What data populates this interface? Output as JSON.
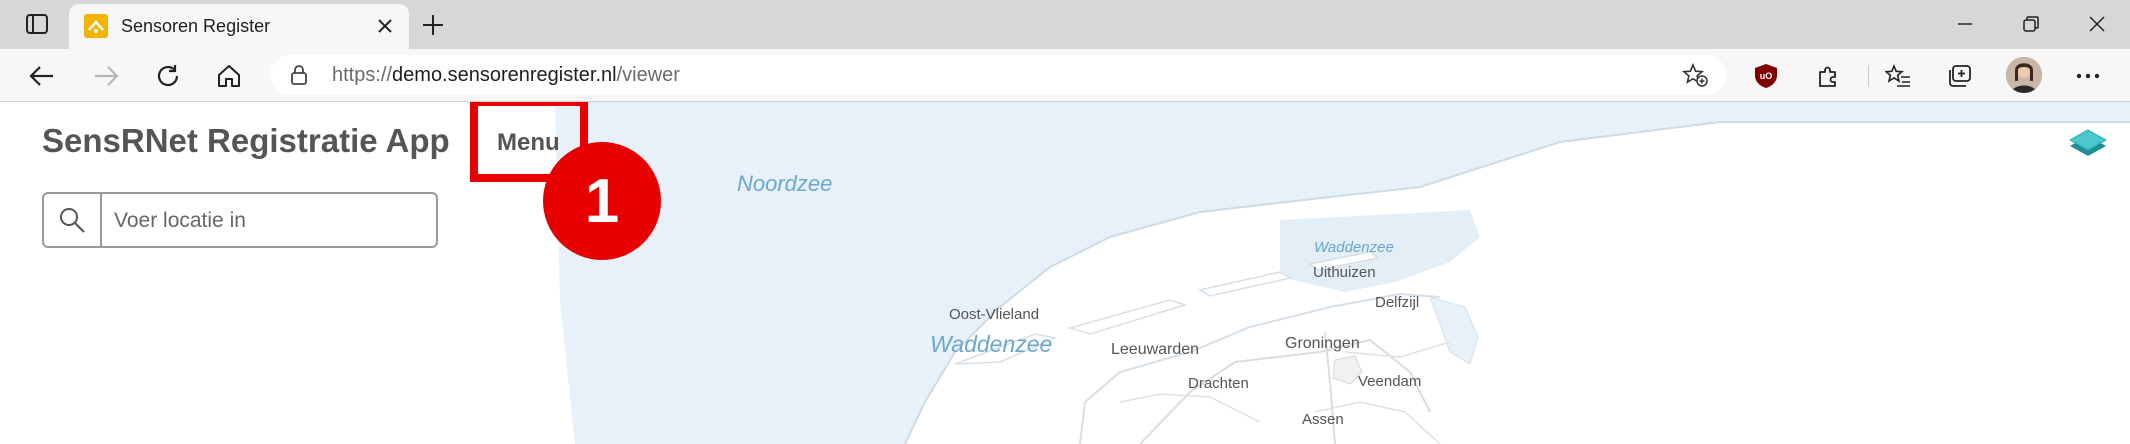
{
  "browser": {
    "tab": {
      "title": "Sensoren Register"
    },
    "address": {
      "protocol": "https://",
      "host": "demo.sensorenregister.nl",
      "path": "/viewer"
    }
  },
  "app": {
    "title": "SensRNet Registratie App",
    "menu_label": "Menu",
    "step_number": "1",
    "search": {
      "placeholder": "Voer locatie in",
      "value": ""
    }
  },
  "map": {
    "labels": {
      "noordzee": "Noordzee",
      "waddenzee_large": "Waddenzee",
      "waddenzee_small": "Waddenzee",
      "oost_vlieland": "Oost-Vlieland",
      "uithuizen": "Uithuizen",
      "delfzijl": "Delfzijl",
      "leeuwarden": "Leeuwarden",
      "groningen": "Groningen",
      "drachten": "Drachten",
      "veendam": "Veendam",
      "assen": "Assen"
    },
    "colors": {
      "water": "#e8f1f9",
      "water_label": "#6aa6cf",
      "land": "#ffffff",
      "road": "#dcdcdc",
      "place_label": "#555555"
    }
  },
  "colors": {
    "accent_highlight": "#e60000",
    "title_text": "#555555"
  }
}
